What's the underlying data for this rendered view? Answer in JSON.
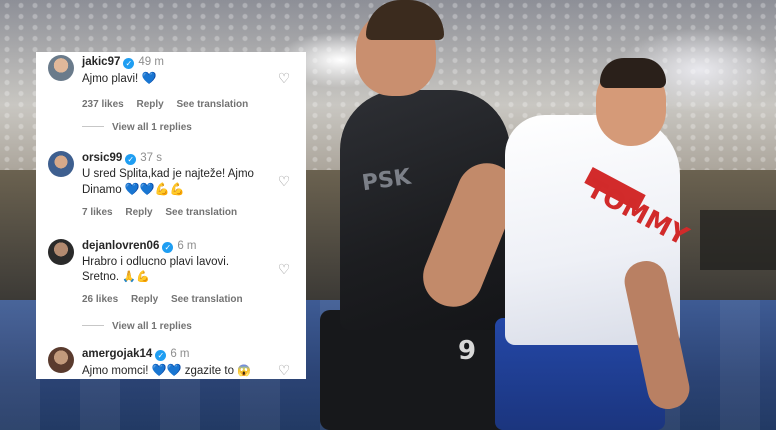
{
  "comments": [
    {
      "username": "jakic97",
      "time": "49 m",
      "text": "Ajmo plavi!",
      "emojis": "💙",
      "likes": "237 likes",
      "reply_label": "Reply",
      "translate_label": "See translation",
      "view_replies": "View all 1 replies"
    },
    {
      "username": "orsic99",
      "time": "37 s",
      "text": "U sred Splita,kad je najteže! Ajmo Dinamo",
      "emojis": "💙💙💪💪",
      "likes": "7 likes",
      "reply_label": "Reply",
      "translate_label": "See translation"
    },
    {
      "username": "dejanlovren06",
      "time": "6 m",
      "text_line1": "Hrabro i odlucno plavi lavovi.",
      "text_line2": "Sretno.",
      "emojis": "🙏💪",
      "likes": "26 likes",
      "reply_label": "Reply",
      "translate_label": "See translation",
      "view_replies": "View all 1 replies"
    },
    {
      "username": "amergojak14",
      "time": "6 m",
      "text": "Ajmo momci!",
      "emojis": "💙💙",
      "text_after": "zgazite to",
      "emoji_end": "😱"
    }
  ],
  "icons": {
    "verified": "verified-badge-icon",
    "like": "heart-outline-icon"
  },
  "photo": {
    "jersey_number": "9",
    "sponsor_dark": "PSK",
    "sponsor_white": "TOMMY"
  },
  "colors": {
    "verified_blue": "#1f9ef2",
    "heart_blue": "#2f79d9",
    "text": "#262626",
    "muted": "#737373"
  }
}
